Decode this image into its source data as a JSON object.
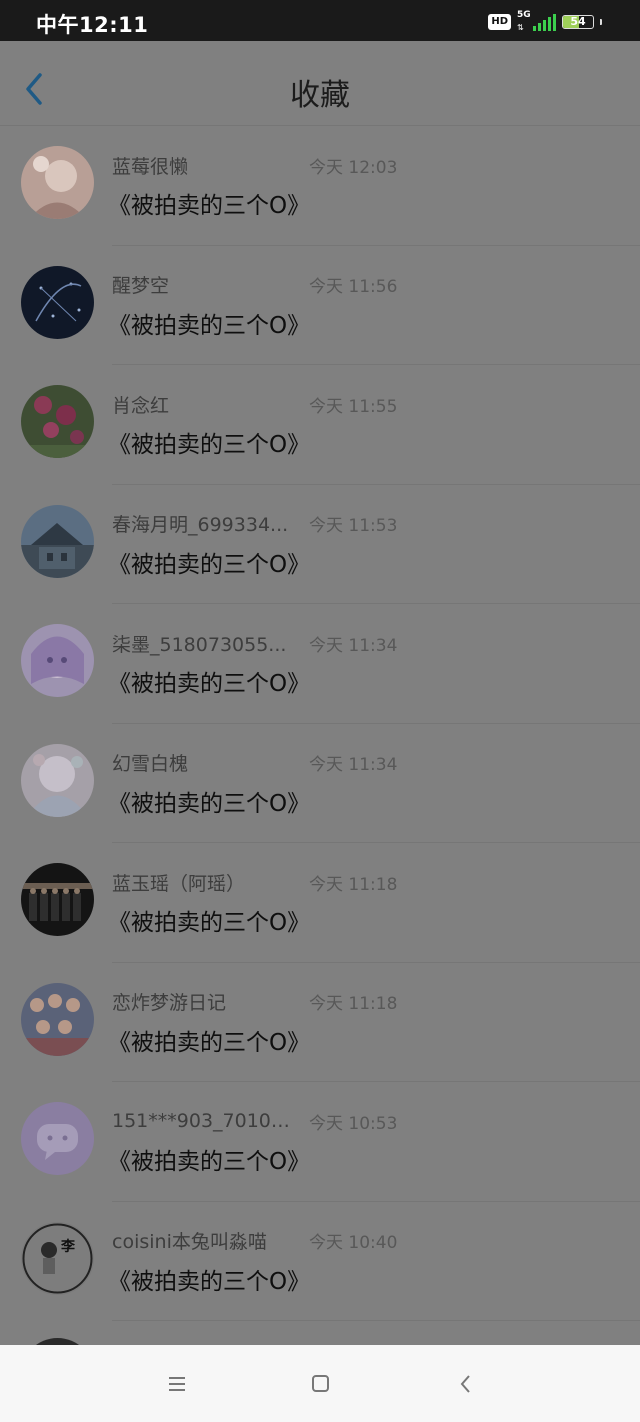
{
  "status_bar": {
    "time": "中午12:11",
    "hd": "HD",
    "network": "5G",
    "battery": "54",
    "battery_level": 0.54
  },
  "header": {
    "title": "收藏",
    "back_icon": "chevron-left-icon"
  },
  "items": [
    {
      "name": "蓝莓很懒",
      "time": "今天 12:03",
      "content": "《被拍卖的三个O》",
      "avatar_style": "photo-soft"
    },
    {
      "name": "醒梦空",
      "time": "今天 11:56",
      "content": "《被拍卖的三个O》",
      "avatar_style": "night-sky"
    },
    {
      "name": "肖念红",
      "time": "今天 11:55",
      "content": "《被拍卖的三个O》",
      "avatar_style": "flowers"
    },
    {
      "name": "春海月明_699334...",
      "time": "今天 11:53",
      "content": "《被拍卖的三个O》",
      "avatar_style": "house"
    },
    {
      "name": "柒墨_518073055...",
      "time": "今天 11:34",
      "content": "《被拍卖的三个O》",
      "avatar_style": "anime-purple"
    },
    {
      "name": "幻雪白槐",
      "time": "今天 11:34",
      "content": "《被拍卖的三个O》",
      "avatar_style": "pastel"
    },
    {
      "name": "蓝玉瑶（阿瑶）",
      "time": "今天 11:18",
      "content": "《被拍卖的三个O》",
      "avatar_style": "group-dark"
    },
    {
      "name": "恋炸梦游日记",
      "time": "今天 11:18",
      "content": "《被拍卖的三个O》",
      "avatar_style": "group-color"
    },
    {
      "name": "151***903_70106...",
      "time": "今天 10:53",
      "content": "《被拍卖的三个O》",
      "avatar_style": "chat-default"
    },
    {
      "name": "coisini本兔叫淼喵",
      "time": "今天 10:40",
      "content": "《被拍卖的三个O》",
      "avatar_style": "sketch",
      "avatar_text": "李"
    }
  ],
  "colors": {
    "overlay": "#808080",
    "status_bg": "#1a1a1a",
    "accent": "#1f5a85",
    "nav_bg": "#f7f7f7"
  },
  "nav_bar": {
    "menu_icon": "menu-icon",
    "home_icon": "square-home-icon",
    "back_icon": "back-chevron-icon"
  }
}
